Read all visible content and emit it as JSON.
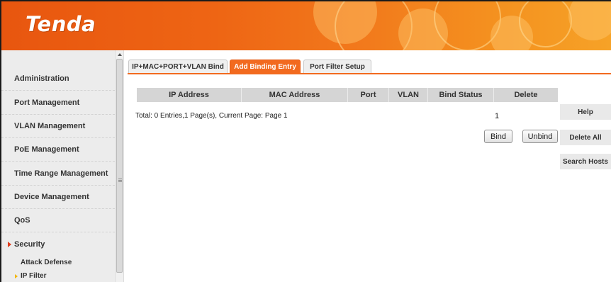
{
  "brand": {
    "logo_text": "Tenda",
    "accent_color": "#f26a1f"
  },
  "sidebar": {
    "items": [
      {
        "label": "Administration"
      },
      {
        "label": "Port Management"
      },
      {
        "label": "VLAN Management"
      },
      {
        "label": "PoE Management"
      },
      {
        "label": "Time Range Management"
      },
      {
        "label": "Device Management"
      },
      {
        "label": "QoS"
      },
      {
        "label": "Security",
        "expanded": true
      }
    ],
    "sub_items": [
      {
        "label": "Attack Defense"
      },
      {
        "label": "IP Filter",
        "selected": true
      }
    ]
  },
  "tabs": [
    {
      "label": "IP+MAC+PORT+VLAN Bind",
      "active": false
    },
    {
      "label": "Add Binding Entry",
      "active": true
    },
    {
      "label": "Port Filter Setup",
      "active": false
    }
  ],
  "table": {
    "columns": [
      "IP Address",
      "MAC Address",
      "Port",
      "VLAN",
      "Bind Status",
      "Delete"
    ],
    "rows": []
  },
  "pagination": {
    "summary": "Total: 0 Entries,1 Page(s), Current Page: Page 1",
    "page_number": "1"
  },
  "actions": {
    "bind_label": "Bind",
    "unbind_label": "Unbind"
  },
  "side_buttons": {
    "help_label": "Help",
    "delete_all_label": "Delete All",
    "search_hosts_label": "Search Hosts"
  }
}
